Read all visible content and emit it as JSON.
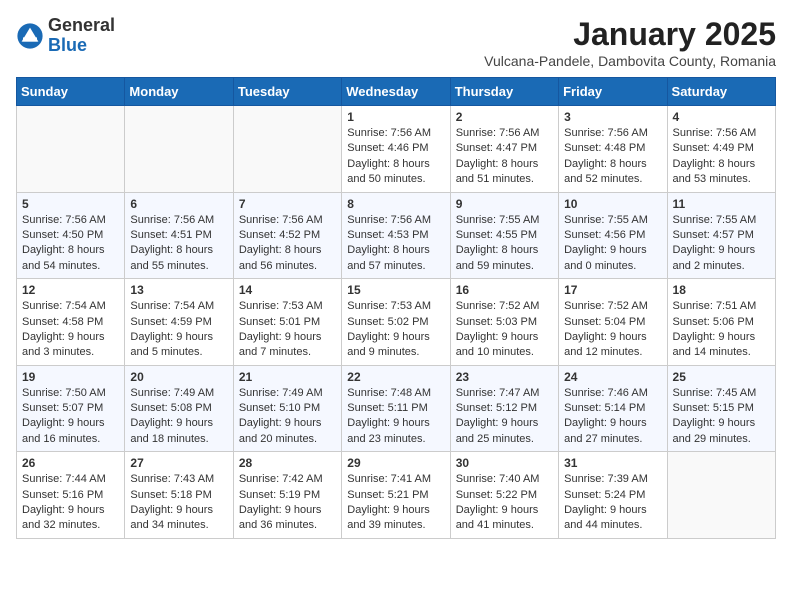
{
  "logo": {
    "general": "General",
    "blue": "Blue"
  },
  "title": "January 2025",
  "location": "Vulcana-Pandele, Dambovita County, Romania",
  "weekdays": [
    "Sunday",
    "Monday",
    "Tuesday",
    "Wednesday",
    "Thursday",
    "Friday",
    "Saturday"
  ],
  "weeks": [
    [
      {
        "day": "",
        "sunrise": "",
        "sunset": "",
        "daylight": ""
      },
      {
        "day": "",
        "sunrise": "",
        "sunset": "",
        "daylight": ""
      },
      {
        "day": "",
        "sunrise": "",
        "sunset": "",
        "daylight": ""
      },
      {
        "day": "1",
        "sunrise": "Sunrise: 7:56 AM",
        "sunset": "Sunset: 4:46 PM",
        "daylight": "Daylight: 8 hours and 50 minutes."
      },
      {
        "day": "2",
        "sunrise": "Sunrise: 7:56 AM",
        "sunset": "Sunset: 4:47 PM",
        "daylight": "Daylight: 8 hours and 51 minutes."
      },
      {
        "day": "3",
        "sunrise": "Sunrise: 7:56 AM",
        "sunset": "Sunset: 4:48 PM",
        "daylight": "Daylight: 8 hours and 52 minutes."
      },
      {
        "day": "4",
        "sunrise": "Sunrise: 7:56 AM",
        "sunset": "Sunset: 4:49 PM",
        "daylight": "Daylight: 8 hours and 53 minutes."
      }
    ],
    [
      {
        "day": "5",
        "sunrise": "Sunrise: 7:56 AM",
        "sunset": "Sunset: 4:50 PM",
        "daylight": "Daylight: 8 hours and 54 minutes."
      },
      {
        "day": "6",
        "sunrise": "Sunrise: 7:56 AM",
        "sunset": "Sunset: 4:51 PM",
        "daylight": "Daylight: 8 hours and 55 minutes."
      },
      {
        "day": "7",
        "sunrise": "Sunrise: 7:56 AM",
        "sunset": "Sunset: 4:52 PM",
        "daylight": "Daylight: 8 hours and 56 minutes."
      },
      {
        "day": "8",
        "sunrise": "Sunrise: 7:56 AM",
        "sunset": "Sunset: 4:53 PM",
        "daylight": "Daylight: 8 hours and 57 minutes."
      },
      {
        "day": "9",
        "sunrise": "Sunrise: 7:55 AM",
        "sunset": "Sunset: 4:55 PM",
        "daylight": "Daylight: 8 hours and 59 minutes."
      },
      {
        "day": "10",
        "sunrise": "Sunrise: 7:55 AM",
        "sunset": "Sunset: 4:56 PM",
        "daylight": "Daylight: 9 hours and 0 minutes."
      },
      {
        "day": "11",
        "sunrise": "Sunrise: 7:55 AM",
        "sunset": "Sunset: 4:57 PM",
        "daylight": "Daylight: 9 hours and 2 minutes."
      }
    ],
    [
      {
        "day": "12",
        "sunrise": "Sunrise: 7:54 AM",
        "sunset": "Sunset: 4:58 PM",
        "daylight": "Daylight: 9 hours and 3 minutes."
      },
      {
        "day": "13",
        "sunrise": "Sunrise: 7:54 AM",
        "sunset": "Sunset: 4:59 PM",
        "daylight": "Daylight: 9 hours and 5 minutes."
      },
      {
        "day": "14",
        "sunrise": "Sunrise: 7:53 AM",
        "sunset": "Sunset: 5:01 PM",
        "daylight": "Daylight: 9 hours and 7 minutes."
      },
      {
        "day": "15",
        "sunrise": "Sunrise: 7:53 AM",
        "sunset": "Sunset: 5:02 PM",
        "daylight": "Daylight: 9 hours and 9 minutes."
      },
      {
        "day": "16",
        "sunrise": "Sunrise: 7:52 AM",
        "sunset": "Sunset: 5:03 PM",
        "daylight": "Daylight: 9 hours and 10 minutes."
      },
      {
        "day": "17",
        "sunrise": "Sunrise: 7:52 AM",
        "sunset": "Sunset: 5:04 PM",
        "daylight": "Daylight: 9 hours and 12 minutes."
      },
      {
        "day": "18",
        "sunrise": "Sunrise: 7:51 AM",
        "sunset": "Sunset: 5:06 PM",
        "daylight": "Daylight: 9 hours and 14 minutes."
      }
    ],
    [
      {
        "day": "19",
        "sunrise": "Sunrise: 7:50 AM",
        "sunset": "Sunset: 5:07 PM",
        "daylight": "Daylight: 9 hours and 16 minutes."
      },
      {
        "day": "20",
        "sunrise": "Sunrise: 7:49 AM",
        "sunset": "Sunset: 5:08 PM",
        "daylight": "Daylight: 9 hours and 18 minutes."
      },
      {
        "day": "21",
        "sunrise": "Sunrise: 7:49 AM",
        "sunset": "Sunset: 5:10 PM",
        "daylight": "Daylight: 9 hours and 20 minutes."
      },
      {
        "day": "22",
        "sunrise": "Sunrise: 7:48 AM",
        "sunset": "Sunset: 5:11 PM",
        "daylight": "Daylight: 9 hours and 23 minutes."
      },
      {
        "day": "23",
        "sunrise": "Sunrise: 7:47 AM",
        "sunset": "Sunset: 5:12 PM",
        "daylight": "Daylight: 9 hours and 25 minutes."
      },
      {
        "day": "24",
        "sunrise": "Sunrise: 7:46 AM",
        "sunset": "Sunset: 5:14 PM",
        "daylight": "Daylight: 9 hours and 27 minutes."
      },
      {
        "day": "25",
        "sunrise": "Sunrise: 7:45 AM",
        "sunset": "Sunset: 5:15 PM",
        "daylight": "Daylight: 9 hours and 29 minutes."
      }
    ],
    [
      {
        "day": "26",
        "sunrise": "Sunrise: 7:44 AM",
        "sunset": "Sunset: 5:16 PM",
        "daylight": "Daylight: 9 hours and 32 minutes."
      },
      {
        "day": "27",
        "sunrise": "Sunrise: 7:43 AM",
        "sunset": "Sunset: 5:18 PM",
        "daylight": "Daylight: 9 hours and 34 minutes."
      },
      {
        "day": "28",
        "sunrise": "Sunrise: 7:42 AM",
        "sunset": "Sunset: 5:19 PM",
        "daylight": "Daylight: 9 hours and 36 minutes."
      },
      {
        "day": "29",
        "sunrise": "Sunrise: 7:41 AM",
        "sunset": "Sunset: 5:21 PM",
        "daylight": "Daylight: 9 hours and 39 minutes."
      },
      {
        "day": "30",
        "sunrise": "Sunrise: 7:40 AM",
        "sunset": "Sunset: 5:22 PM",
        "daylight": "Daylight: 9 hours and 41 minutes."
      },
      {
        "day": "31",
        "sunrise": "Sunrise: 7:39 AM",
        "sunset": "Sunset: 5:24 PM",
        "daylight": "Daylight: 9 hours and 44 minutes."
      },
      {
        "day": "",
        "sunrise": "",
        "sunset": "",
        "daylight": ""
      }
    ]
  ]
}
